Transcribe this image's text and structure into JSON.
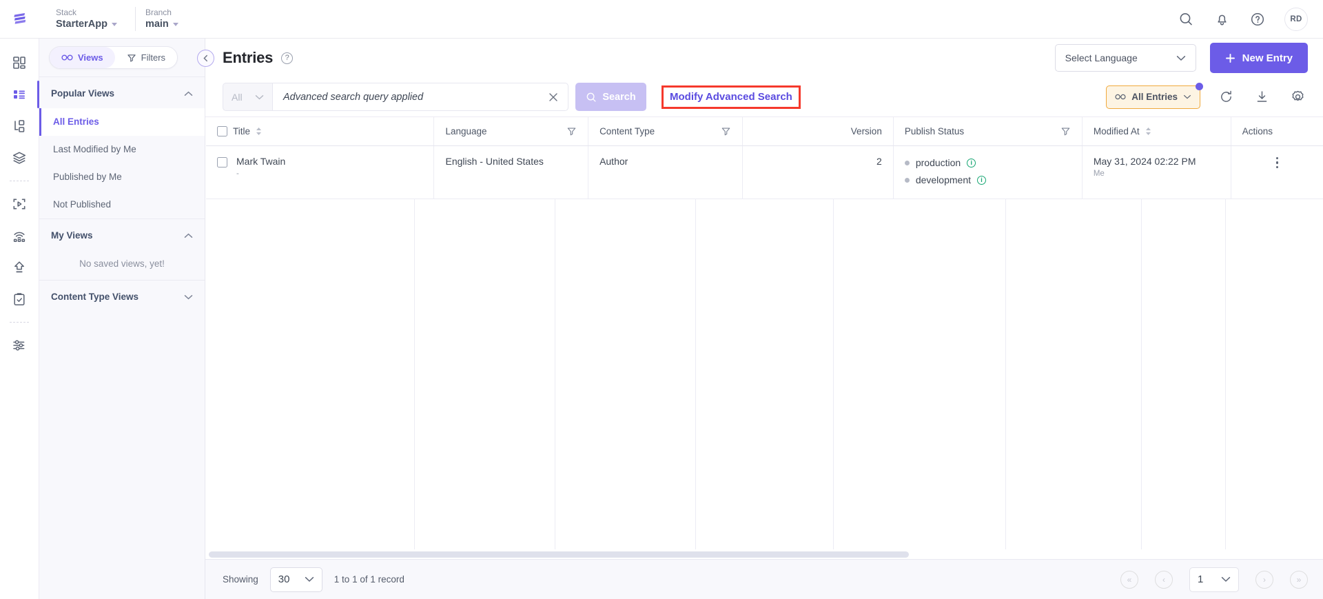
{
  "topbar": {
    "logo_icon": "contentstack-logo-icon",
    "context": [
      {
        "label": "Stack",
        "value": "StarterApp"
      },
      {
        "label": "Branch",
        "value": "main"
      }
    ],
    "icons": [
      {
        "name": "search-icon"
      },
      {
        "name": "bell-icon"
      },
      {
        "name": "help-icon"
      }
    ],
    "avatar_initials": "RD"
  },
  "rail": {
    "items": [
      {
        "name": "dashboard-icon",
        "active": false
      },
      {
        "name": "entries-icon",
        "active": true
      },
      {
        "name": "content-types-icon",
        "active": false
      },
      {
        "name": "assets-icon",
        "active": false
      },
      {
        "name": "live-preview-icon",
        "active": false
      },
      {
        "name": "publish-queue-icon",
        "active": false
      },
      {
        "name": "releases-icon",
        "active": false
      },
      {
        "name": "tasks-icon",
        "active": false
      },
      {
        "name": "settings-icon",
        "active": false
      }
    ]
  },
  "sidebar": {
    "toggle": {
      "views_label": "Views",
      "filters_label": "Filters"
    },
    "sections": [
      {
        "title": "Popular Views",
        "collapsed": false,
        "items": [
          {
            "label": "All Entries",
            "active": true
          },
          {
            "label": "Last Modified by Me",
            "active": false
          },
          {
            "label": "Published by Me",
            "active": false
          },
          {
            "label": "Not Published",
            "active": false
          }
        ]
      },
      {
        "title": "My Views",
        "collapsed": false,
        "empty_text": "No saved views, yet!",
        "items": []
      },
      {
        "title": "Content Type Views",
        "collapsed": true,
        "items": []
      }
    ]
  },
  "page": {
    "title": "Entries",
    "help_glyph": "?",
    "language_select": "Select Language",
    "new_entry_label": "New Entry"
  },
  "search": {
    "scope_value": "All",
    "query_text": "Advanced search query applied",
    "search_button_label": "Search",
    "modify_link_label": "Modify Advanced Search",
    "view_chip_label": "All Entries",
    "right_icons": [
      {
        "name": "refresh-icon"
      },
      {
        "name": "download-icon"
      },
      {
        "name": "gear-icon"
      }
    ]
  },
  "table": {
    "columns": [
      {
        "key": "title",
        "label": "Title",
        "sortable": true,
        "filterable": false,
        "align": "left"
      },
      {
        "key": "language",
        "label": "Language",
        "sortable": false,
        "filterable": true,
        "align": "left"
      },
      {
        "key": "content_type",
        "label": "Content Type",
        "sortable": false,
        "filterable": true,
        "align": "left"
      },
      {
        "key": "version",
        "label": "Version",
        "sortable": false,
        "filterable": false,
        "align": "right"
      },
      {
        "key": "publish_status",
        "label": "Publish Status",
        "sortable": false,
        "filterable": true,
        "align": "left"
      },
      {
        "key": "modified_at",
        "label": "Modified At",
        "sortable": true,
        "filterable": false,
        "align": "left"
      },
      {
        "key": "actions",
        "label": "Actions",
        "sortable": false,
        "filterable": false,
        "align": "left"
      }
    ],
    "rows": [
      {
        "title": "Mark Twain",
        "subtitle": "-",
        "language": "English - United States",
        "content_type": "Author",
        "version": "2",
        "publish_status": [
          {
            "env": "production"
          },
          {
            "env": "development"
          }
        ],
        "modified_at": "May 31, 2024 02:22 PM",
        "modified_by": "Me"
      }
    ]
  },
  "footer": {
    "showing_label": "Showing",
    "page_size": "30",
    "record_range": "1 to 1 of 1 record",
    "current_page": "1",
    "nav": [
      {
        "name": "first-page-button",
        "glyph": "«"
      },
      {
        "name": "prev-page-button",
        "glyph": "‹"
      },
      {
        "name": "next-page-button",
        "glyph": "›"
      },
      {
        "name": "last-page-button",
        "glyph": "»"
      }
    ]
  },
  "colors": {
    "accent": "#6c5ce7",
    "highlight_box": "#f5392c",
    "chip_border": "#f0a93c",
    "status_info": "#17a673"
  }
}
